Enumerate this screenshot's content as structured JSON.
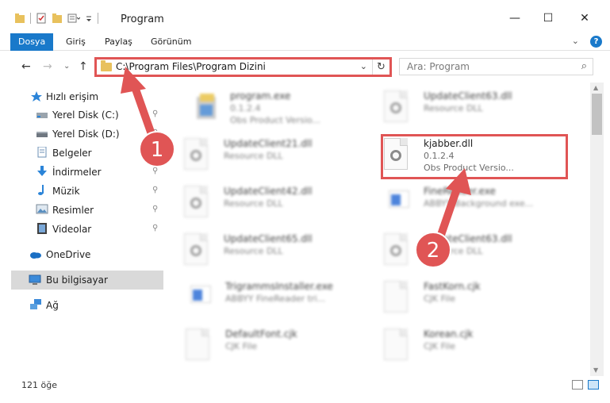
{
  "window": {
    "title": "Program",
    "controls": {
      "minimize": "—",
      "maximize": "☐",
      "close": "✕"
    }
  },
  "ribbon": {
    "tabs": [
      {
        "label": "Dosya",
        "active": true
      },
      {
        "label": "Giriş"
      },
      {
        "label": "Paylaş"
      },
      {
        "label": "Görünüm"
      }
    ],
    "expand_glyph": "⌄",
    "help": "?"
  },
  "nav": {
    "back": "←",
    "forward": "→",
    "recent": "⌄",
    "up": "↑",
    "address_path": "C:\\Program Files\\Program Dizini",
    "address_dropdown": "⌄",
    "refresh": "↻",
    "search_placeholder": "Ara: Program",
    "search_icon": "⌕"
  },
  "sidebar": {
    "items": [
      {
        "label": "Hızlı erişim",
        "icon": "star-icon",
        "pinned": false
      },
      {
        "label": "Yerel Disk (C:)",
        "icon": "drive-icon",
        "pinned": true
      },
      {
        "label": "Yerel Disk (D:)",
        "icon": "drive-icon",
        "pinned": true
      },
      {
        "label": "Belgeler",
        "icon": "document-icon",
        "pinned": true
      },
      {
        "label": "İndirmeler",
        "icon": "download-icon",
        "pinned": true
      },
      {
        "label": "Müzik",
        "icon": "music-icon",
        "pinned": true
      },
      {
        "label": "Resimler",
        "icon": "pictures-icon",
        "pinned": true
      },
      {
        "label": "Videolar",
        "icon": "video-icon",
        "pinned": true
      },
      {
        "label": "OneDrive",
        "icon": "cloud-icon",
        "pinned": false
      },
      {
        "label": "Bu bilgisayar",
        "icon": "computer-icon",
        "pinned": false,
        "selected": true
      },
      {
        "label": "Ağ",
        "icon": "network-icon",
        "pinned": false
      }
    ],
    "pin_glyph": "📌"
  },
  "files": [
    {
      "name": "program.exe",
      "meta1": "0.1.2.4",
      "meta2": "Obs   Product Versio...",
      "icon": "installer-icon",
      "blurred": true
    },
    {
      "name": "UpdateClient63.dll",
      "meta1": "Resource DLL",
      "meta2": "",
      "icon": "dll-icon",
      "blurred": true
    },
    {
      "name": "UpdateClient21.dll",
      "meta1": "Resource DLL",
      "meta2": "",
      "icon": "dll-icon",
      "blurred": true
    },
    {
      "name": "kjabber.dll",
      "meta1": "0.1.2.4",
      "meta2": "Obs   Product Versio...",
      "icon": "dll-gear-icon",
      "blurred": false
    },
    {
      "name": "UpdateClient42.dll",
      "meta1": "Resource DLL",
      "meta2": "",
      "icon": "dll-icon",
      "blurred": true
    },
    {
      "name": "FineReader.exe",
      "meta1": "ABBYY Background exe...",
      "meta2": "",
      "icon": "app-icon",
      "blurred": true
    },
    {
      "name": "UpdateClient65.dll",
      "meta1": "Resource DLL",
      "meta2": "",
      "icon": "dll-icon",
      "blurred": true
    },
    {
      "name": "UpdateClient63.dll",
      "meta1": "Resource DLL",
      "meta2": "",
      "icon": "dll-icon",
      "blurred": true
    },
    {
      "name": "TrigrammsInstaller.exe",
      "meta1": "ABBYY FineReader tri...",
      "meta2": "",
      "icon": "app-icon",
      "blurred": true
    },
    {
      "name": "FastKorn.cjk",
      "meta1": "CJK File",
      "meta2": "",
      "icon": "file-icon",
      "blurred": true
    },
    {
      "name": "DefaultFont.cjk",
      "meta1": "CJK File",
      "meta2": "",
      "icon": "file-icon",
      "blurred": true
    },
    {
      "name": "Korean.cjk",
      "meta1": "CJK File",
      "meta2": "",
      "icon": "file-icon",
      "blurred": true
    }
  ],
  "status": {
    "item_count": "121 öğe"
  },
  "annotations": {
    "callout_1": "1",
    "callout_2": "2",
    "highlight_color": "#e05555"
  },
  "colors": {
    "accent": "#1979ca",
    "annotation": "#e05555",
    "selected_bg": "#d9d9d9"
  }
}
